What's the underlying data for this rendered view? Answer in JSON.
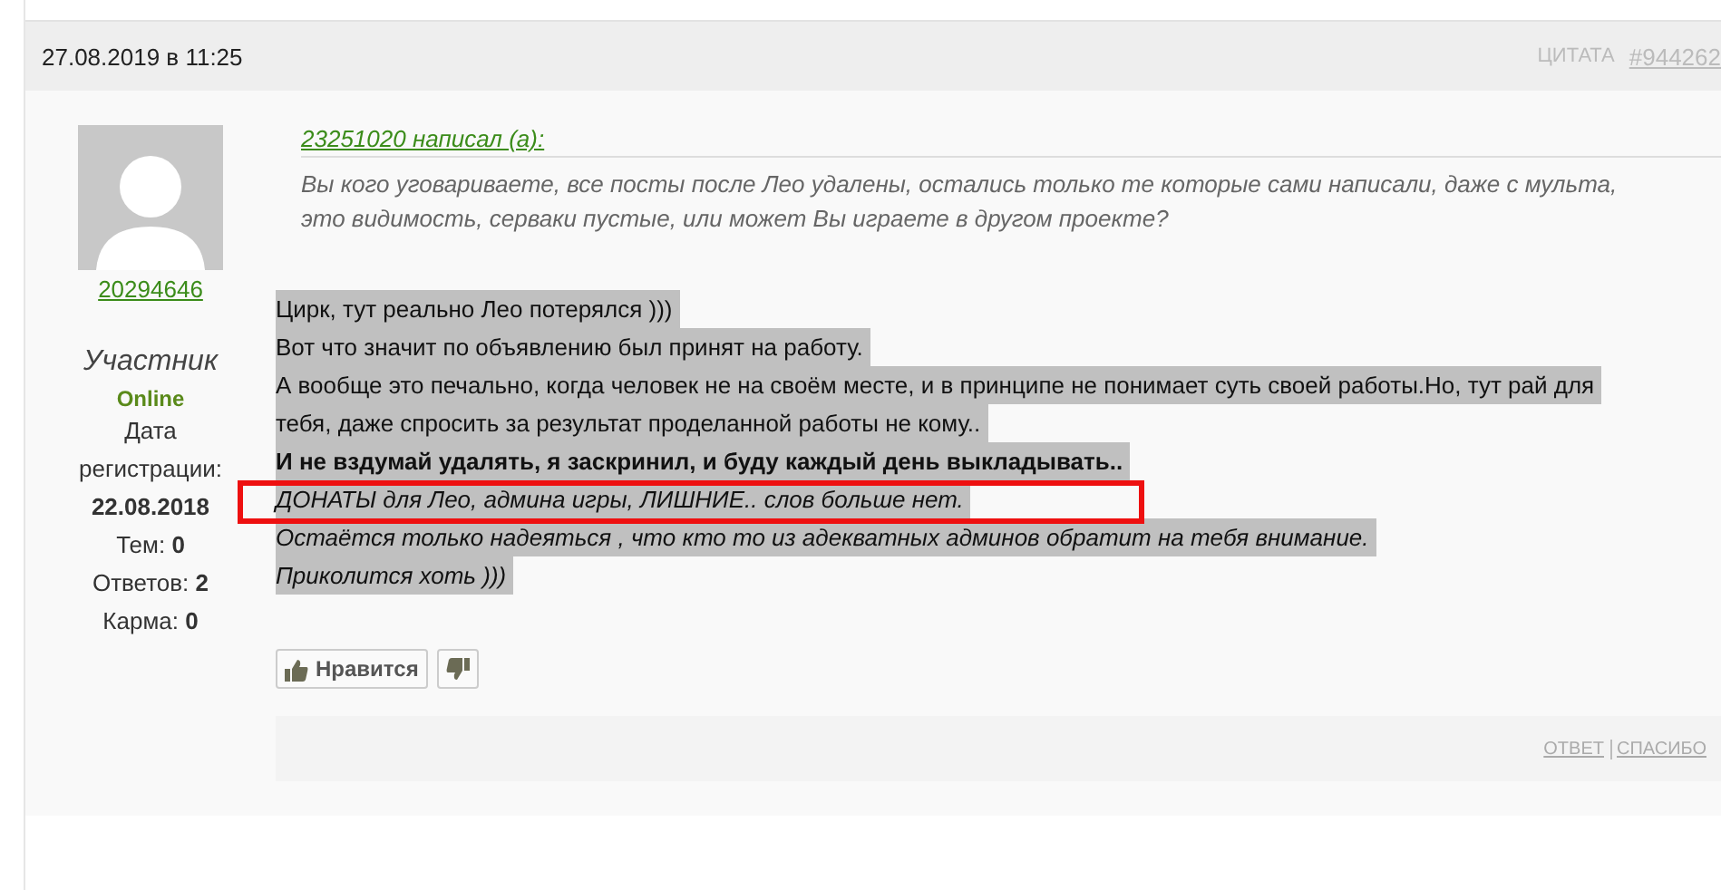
{
  "post": {
    "date": "27.08.2019 в 11:25",
    "quote_label": "ЦИТАТА",
    "post_number": "#944262",
    "author": {
      "name": "20294646",
      "rank": "Участник",
      "status": "Online",
      "stats": [
        {
          "label": "Дата регистрации:",
          "value": "22.08.2018",
          "kind": "block"
        },
        {
          "label": "Тем:",
          "value": "0",
          "kind": "inline"
        },
        {
          "label": "Ответов:",
          "value": "2",
          "kind": "inline"
        },
        {
          "label": "Карма:",
          "value": "0",
          "kind": "inline"
        }
      ]
    },
    "quote": {
      "author": "23251020 написал (а):",
      "lines": [
        "Вы кого уговариваете, все посты после Лео удалены, остались только те которые сами написали, даже с мульта,",
        "это видимость, серваки пустые, или может Вы играете в другом проекте?"
      ]
    },
    "lines": [
      {
        "text": "Цирк, тут реально Лео потерялся )))",
        "kind": "normal",
        "selected": true,
        "annotated": false
      },
      {
        "text": "Вот что значит по объявлению был принят на работу.",
        "kind": "normal",
        "selected": true,
        "annotated": false
      },
      {
        "text": "А вообще это печально, когда человек не на своём месте, и в принципе не понимает суть своей работы.Но, тут рай для",
        "kind": "normal",
        "selected": true,
        "annotated": false
      },
      {
        "text": "тебя, даже спросить за результат проделанной работы не кому..",
        "kind": "normal",
        "selected": true,
        "annotated": false
      },
      {
        "text": "И не вздумай удалять, я заскринил, и буду каждый день выкладывать..",
        "kind": "bold",
        "selected": true,
        "annotated": false
      },
      {
        "text": "ДОНАТЫ для Лео, админа игры, ЛИШНИЕ.. слов больше нет.",
        "kind": "italic",
        "selected": true,
        "annotated": true
      },
      {
        "text": "Остаётся только надеяться , что кто то из адекватных админов обратит на тебя внимание.",
        "kind": "italic",
        "selected": true,
        "annotated": false
      },
      {
        "text": "Приколится хоть )))",
        "kind": "italic",
        "selected": true,
        "annotated": false
      }
    ],
    "like_button": "Нравится",
    "footer_links": [
      "ОТВЕТ",
      "СПАСИБО"
    ]
  }
}
